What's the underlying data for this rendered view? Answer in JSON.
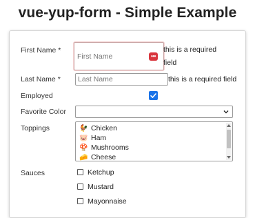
{
  "page": {
    "title": "vue-yup-form - Simple Example"
  },
  "form": {
    "first_name": {
      "label": "First Name *",
      "placeholder": "First Name",
      "value": "",
      "hint": "this is a required field",
      "hint_line1": "this is a required",
      "hint_line2": "field"
    },
    "last_name": {
      "label": "Last Name *",
      "placeholder": "Last Name",
      "value": "",
      "hint": "this is a required field"
    },
    "employed": {
      "label": "Employed",
      "checked": true
    },
    "favorite_color": {
      "label": "Favorite Color",
      "selected": ""
    },
    "toppings": {
      "label": "Toppings",
      "options": [
        {
          "icon": "chicken-icon",
          "glyph": "🐓",
          "label": "Chicken"
        },
        {
          "icon": "pig-icon",
          "glyph": "🐷",
          "label": "Ham"
        },
        {
          "icon": "mushroom-icon",
          "glyph": "🍄",
          "label": "Mushrooms"
        },
        {
          "icon": "cheese-icon",
          "glyph": "🧀",
          "label": "Cheese"
        }
      ]
    },
    "sauces": {
      "label": "Sauces",
      "options": [
        {
          "label": "Ketchup",
          "checked": false
        },
        {
          "label": "Mustard",
          "checked": false
        },
        {
          "label": "Mayonnaise",
          "checked": false
        }
      ]
    }
  },
  "colors": {
    "checkbox_accent": "#1a73e8",
    "password_manager_icon": "#d9363e"
  }
}
